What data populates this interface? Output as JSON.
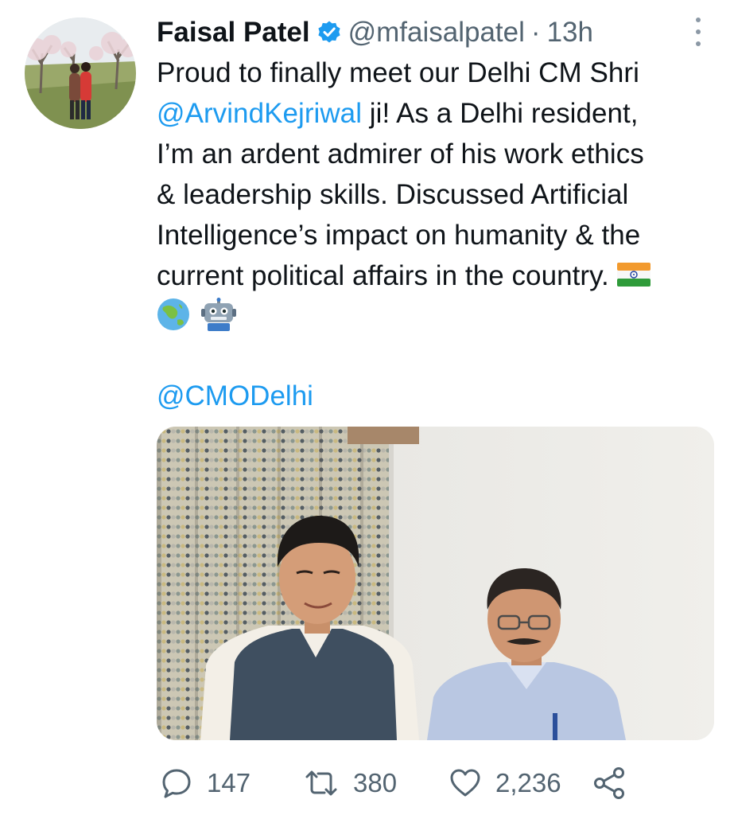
{
  "tweet": {
    "display_name": "Faisal Patel",
    "handle": "@mfaisalpatel",
    "separator": "·",
    "time": "13h",
    "verified_icon": "verified-badge-icon",
    "text_lines": [
      "Proud to finally meet our Delhi CM Shri",
      " ji! As a Delhi resident,",
      "I’m an ardent admirer of his work ethics",
      "& leadership skills. Discussed Artificial",
      "Intelligence’s impact on humanity & the",
      "current political affairs in the country. "
    ],
    "mention_inline": "@ArvindKejriwal",
    "emojis": [
      "india-flag-icon",
      "globe-asia-icon",
      "robot-icon"
    ],
    "mention_footer": "@CMODelhi"
  },
  "actions": {
    "replies": "147",
    "retweets": "380",
    "likes": "2,236"
  },
  "colors": {
    "link": "#1d9bf0",
    "secondary": "#536471",
    "text": "#0f1419"
  }
}
